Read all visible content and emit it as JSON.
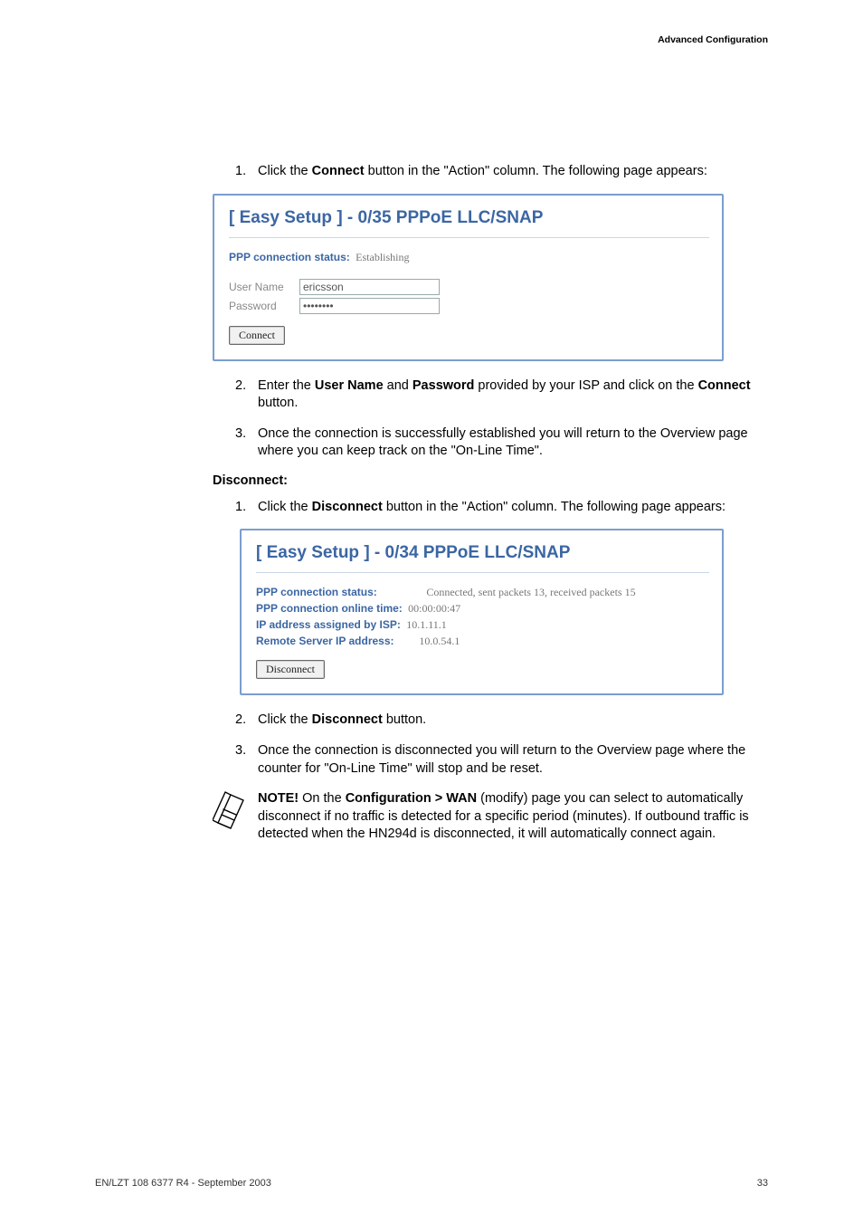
{
  "header": {
    "section": "Advanced Configuration"
  },
  "steps_a": {
    "item1_num": "1.",
    "item1_before": "Click the ",
    "item1_bold": "Connect",
    "item1_after": " button in the \"Action\" column. The following page appears:"
  },
  "panel1": {
    "title": "[ Easy Setup ] - 0/35 PPPoE  LLC/SNAP",
    "status_label": "PPP connection status:",
    "status_value": "Establishing",
    "username_label": "User Name",
    "username_value": "ericsson",
    "password_label": "Password",
    "password_value": "••••••••",
    "connect_btn": "Connect"
  },
  "steps_b": {
    "item2_num": "2.",
    "item2_a": "Enter the ",
    "item2_b1": "User Name",
    "item2_b": " and ",
    "item2_b2": "Password",
    "item2_c": " provided by your ISP and click on the ",
    "item2_b3": "Connect",
    "item2_d": " button.",
    "item3_num": "3.",
    "item3_text": "Once the connection is successfully established you will return to the Overview page where you can keep track on the \"On-Line Time\"."
  },
  "disconnect_heading": "Disconnect:",
  "steps_c": {
    "item1_num": "1.",
    "item1_a": "Click the ",
    "item1_bold": "Disconnect",
    "item1_b": " button in the \"Action\" column. The following page appears:"
  },
  "panel2": {
    "title": "[ Easy Setup ] - 0/34 PPPoE  LLC/SNAP",
    "row1_label": "PPP connection status:",
    "row1_value": "Connected, sent packets 13, received packets 15",
    "row2_label": "PPP connection online time:",
    "row2_value": "00:00:00:47",
    "row3_label": "IP address assigned by ISP:",
    "row3_value": "10.1.11.1",
    "row4_label": "Remote Server IP address:",
    "row4_value": "10.0.54.1",
    "disconnect_btn": "Disconnect"
  },
  "steps_d": {
    "item2_num": "2.",
    "item2_a": "Click the ",
    "item2_bold": "Disconnect",
    "item2_b": " button.",
    "item3_num": "3.",
    "item3_text": "Once the connection is disconnected you will return to the Overview page where the counter for \"On-Line Time\" will stop and be reset."
  },
  "note": {
    "bold1": "NOTE!",
    "t1": " On the ",
    "bold2": "Configuration > WAN",
    "t2": " (modify) page you can select to automatically disconnect if no traffic is detected for a specific period (minutes). If outbound traffic is detected when the HN294d is disconnected, it will automatically connect again."
  },
  "footer": {
    "left": "EN/LZT 108 6377 R4 - September 2003",
    "right": "33"
  }
}
